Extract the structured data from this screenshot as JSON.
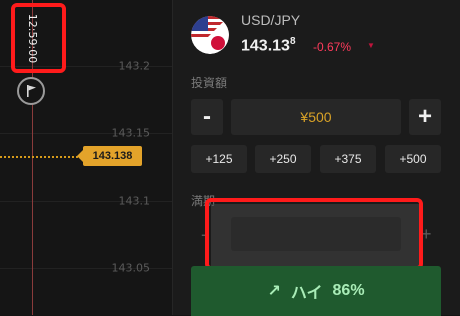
{
  "chart": {
    "time_label": "12:59:00",
    "current_price_tag": "143.138",
    "ticks": [
      {
        "label": "143.2"
      },
      {
        "label": "143.15"
      },
      {
        "label": "143.1"
      },
      {
        "label": "143.05"
      }
    ]
  },
  "asset": {
    "pair": "USD/JPY",
    "price": "143.13",
    "price_pip": "8",
    "change": "-0.67%",
    "change_arrow": "▼"
  },
  "trade": {
    "amount_label": "投資額",
    "minus_label": "-",
    "plus_label": "+",
    "amount_value": "¥500",
    "quick_amounts": [
      "+125",
      "+250",
      "+375",
      "+500"
    ],
    "duration_label": "満期",
    "duration_value": "",
    "high_button": {
      "arrow": "↗",
      "label": "ハイ",
      "payout": "86%"
    }
  },
  "colors": {
    "highlight": "#ff1b1b",
    "price_tag": "#e3a32a",
    "negative": "#ff3b5c",
    "high_button_bg": "#1f5a2e"
  }
}
